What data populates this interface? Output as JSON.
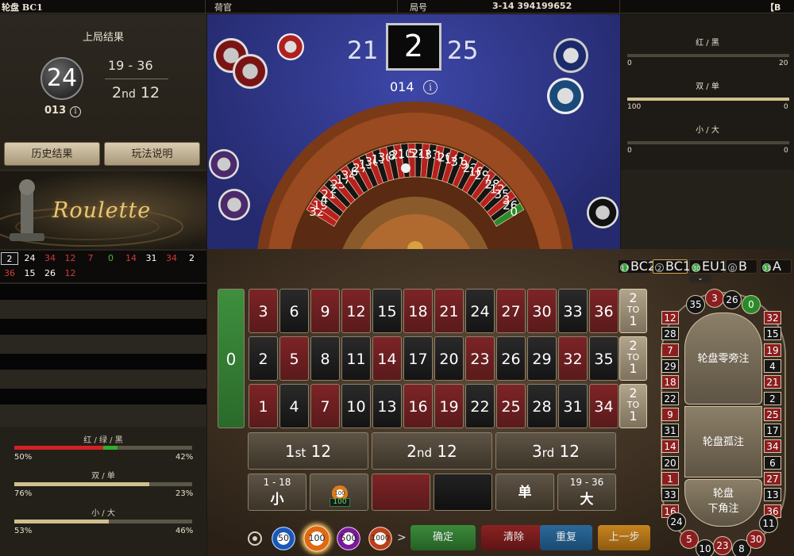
{
  "topbar": {
    "title": "轮盘 BC1",
    "dealer_label": "荷官",
    "round_label": "局号",
    "round_value": "3-14 394199652",
    "right_badge": "【B"
  },
  "last_result": {
    "title": "上局结果",
    "number": "24",
    "round": "013",
    "range": "19 - 36",
    "dozen_num": "2",
    "dozen_suffix": "nd",
    "dozen_rest": " 12",
    "history_button": "历史结果",
    "rules_button": "玩法说明"
  },
  "banner": {
    "text": "Roulette"
  },
  "history": {
    "row1": [
      {
        "n": "2",
        "c": "#ffffff",
        "hl": true
      },
      {
        "n": "24",
        "c": "#ffffff"
      },
      {
        "n": "34",
        "c": "#d23a3a"
      },
      {
        "n": "12",
        "c": "#d23a3a"
      },
      {
        "n": "7",
        "c": "#d23a3a"
      },
      {
        "n": "0",
        "c": "#3fbf3f"
      },
      {
        "n": "14",
        "c": "#d23a3a"
      },
      {
        "n": "31",
        "c": "#ffffff"
      },
      {
        "n": "34",
        "c": "#d23a3a"
      },
      {
        "n": "2",
        "c": "#ffffff"
      }
    ],
    "row2": [
      {
        "n": "36",
        "c": "#d23a3a"
      },
      {
        "n": "15",
        "c": "#ffffff"
      },
      {
        "n": "26",
        "c": "#ffffff"
      },
      {
        "n": "12",
        "c": "#d23a3a"
      }
    ]
  },
  "stats_left": {
    "rgb_label": "红 / 绿 / 黑",
    "rgb_left": "50%",
    "rgb_right": "42%",
    "oe_label": "双 / 单",
    "oe_left": "76%",
    "oe_right": "23%",
    "sb_label": "小 / 大",
    "sb_left": "53%",
    "sb_right": "46%",
    "rgb_fractions": [
      0.5,
      0.08,
      0.42
    ],
    "oe_fraction": 0.76,
    "sb_fraction": 0.53
  },
  "wheel": {
    "prev": "21",
    "current": "2",
    "next": "25",
    "round": "014",
    "wheel_numbers": [
      "32",
      "19",
      "4",
      "21",
      "2",
      "25",
      "17",
      "34",
      "6",
      "27",
      "13",
      "36",
      "11",
      "30",
      "8",
      "23",
      "10",
      "5",
      "24",
      "16",
      "33",
      "1",
      "20",
      "14",
      "31",
      "9",
      "22",
      "18",
      "29",
      "7",
      "28",
      "12",
      "35",
      "3",
      "26",
      "0"
    ]
  },
  "right_stats": {
    "rb_label": "红 / 黑",
    "rb_left": "0",
    "rb_right": "20",
    "oe_label": "双 / 单",
    "oe_left": "100",
    "oe_right": "0",
    "sb_label": "小 / 大",
    "sb_left": "0",
    "sb_right": "0",
    "rb_fraction": 0.0,
    "oe_fraction": 1.0,
    "sb_fraction": 0.0
  },
  "tables_tabs": [
    {
      "num": "17",
      "name": "BC2",
      "dot": "#2fa52f"
    },
    {
      "num": "2",
      "name": "BC1",
      "dot": "#111111",
      "active": true
    },
    {
      "num": "30",
      "name": "EU1",
      "dot": "#2fa52f"
    },
    {
      "num": "0",
      "name": "B",
      "dot": "#111111"
    },
    {
      "num": "31",
      "name": "A",
      "dot": "#2fa52f"
    }
  ],
  "board": {
    "zero": "0",
    "rows": [
      [
        {
          "n": "3",
          "c": "red"
        },
        {
          "n": "6",
          "c": "black"
        },
        {
          "n": "9",
          "c": "red"
        },
        {
          "n": "12",
          "c": "red"
        },
        {
          "n": "15",
          "c": "black"
        },
        {
          "n": "18",
          "c": "red"
        },
        {
          "n": "21",
          "c": "red"
        },
        {
          "n": "24",
          "c": "black"
        },
        {
          "n": "27",
          "c": "red"
        },
        {
          "n": "30",
          "c": "red"
        },
        {
          "n": "33",
          "c": "black"
        },
        {
          "n": "36",
          "c": "red"
        }
      ],
      [
        {
          "n": "2",
          "c": "black"
        },
        {
          "n": "5",
          "c": "red"
        },
        {
          "n": "8",
          "c": "black"
        },
        {
          "n": "11",
          "c": "black"
        },
        {
          "n": "14",
          "c": "red"
        },
        {
          "n": "17",
          "c": "black"
        },
        {
          "n": "20",
          "c": "black"
        },
        {
          "n": "23",
          "c": "red"
        },
        {
          "n": "26",
          "c": "black"
        },
        {
          "n": "29",
          "c": "black"
        },
        {
          "n": "32",
          "c": "red"
        },
        {
          "n": "35",
          "c": "black"
        }
      ],
      [
        {
          "n": "1",
          "c": "red"
        },
        {
          "n": "4",
          "c": "black"
        },
        {
          "n": "7",
          "c": "red"
        },
        {
          "n": "10",
          "c": "black"
        },
        {
          "n": "13",
          "c": "black"
        },
        {
          "n": "16",
          "c": "red"
        },
        {
          "n": "19",
          "c": "red"
        },
        {
          "n": "22",
          "c": "black"
        },
        {
          "n": "25",
          "c": "red"
        },
        {
          "n": "28",
          "c": "black"
        },
        {
          "n": "31",
          "c": "black"
        },
        {
          "n": "34",
          "c": "red"
        }
      ]
    ],
    "to1": {
      "top": "2",
      "mid": "TO",
      "bot": "1"
    },
    "dozens": [
      {
        "num": "1",
        "suf": "st",
        "rest": " 12"
      },
      {
        "num": "2",
        "suf": "nd",
        "rest": " 12"
      },
      {
        "num": "3",
        "suf": "rd",
        "rest": " 12"
      }
    ],
    "low_range": "1 - 18",
    "low_label": "小",
    "placed_chip": "100",
    "placed_amount": "100",
    "odd_label": "单",
    "high_range": "19 - 36",
    "high_label": "大"
  },
  "racetrack": {
    "left": [
      "12",
      "28",
      "7",
      "29",
      "18",
      "22",
      "9",
      "31",
      "14",
      "20",
      "1",
      "33",
      "16"
    ],
    "right": [
      "32",
      "15",
      "19",
      "4",
      "21",
      "2",
      "25",
      "17",
      "34",
      "6",
      "27",
      "13",
      "36"
    ],
    "top": [
      "35",
      "3",
      "26",
      "0"
    ],
    "bottom": [
      "24",
      "5",
      "10",
      "23",
      "8",
      "30",
      "11"
    ],
    "zone1": "轮盘零旁注",
    "zone2": "轮盘孤注",
    "zone3a": "轮盘",
    "zone3b": "下角注"
  },
  "chips": [
    "50",
    "100",
    "500",
    "1000"
  ],
  "actions": {
    "confirm": "确定",
    "clear": "清除",
    "repeat": "重复",
    "undo": "上一步"
  }
}
